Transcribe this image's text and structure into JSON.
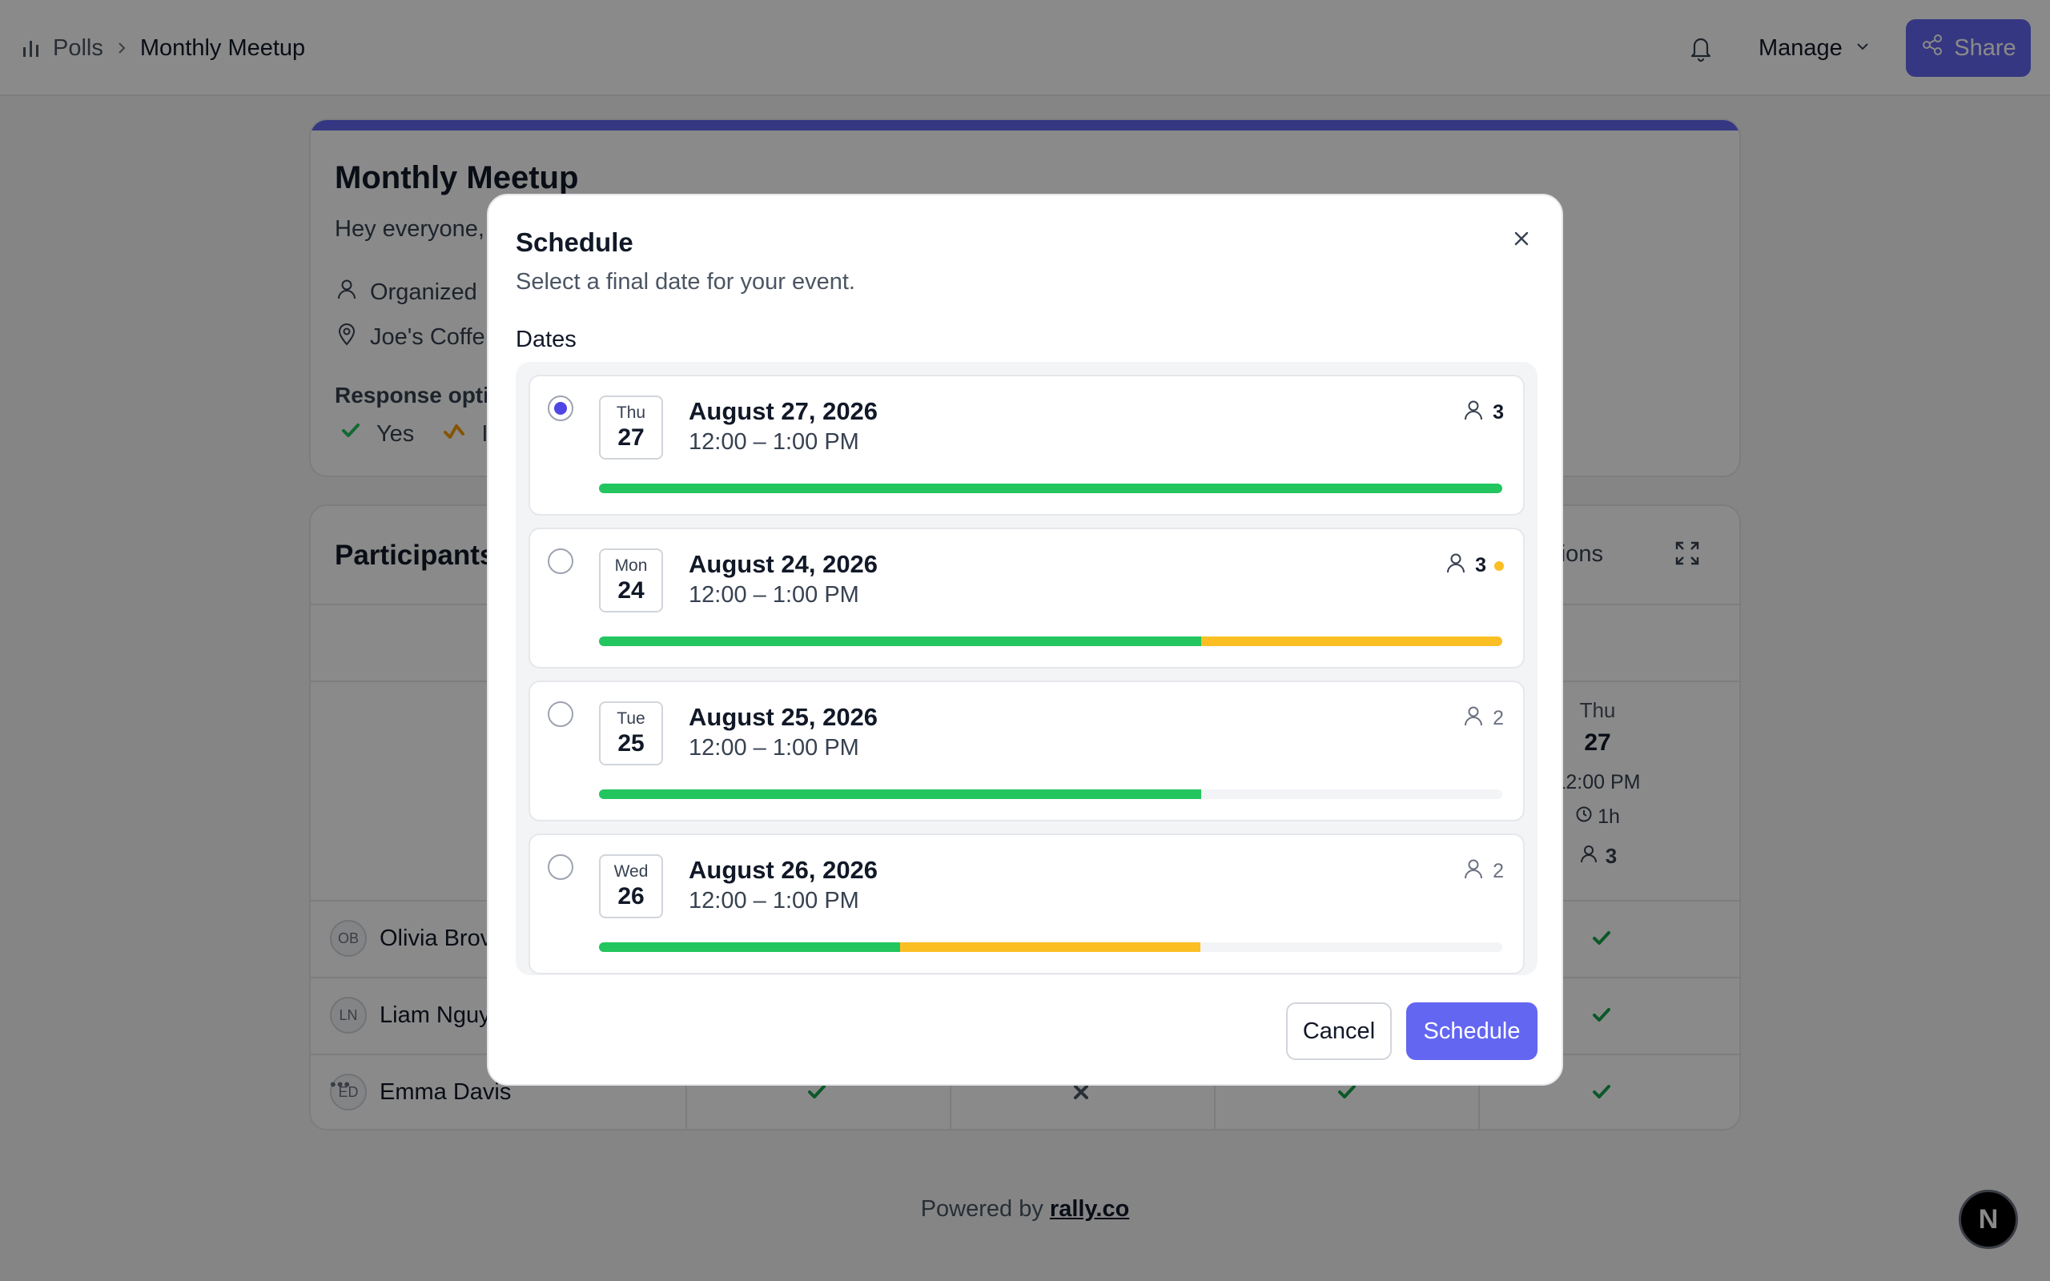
{
  "breadcrumb": {
    "root": "Polls",
    "current": "Monthly Meetup"
  },
  "header": {
    "manage_label": "Manage",
    "share_label": "Share"
  },
  "poll": {
    "title": "Monthly Meetup",
    "description": "Hey everyone,",
    "organizer_text": "Organized",
    "location": "Joe's Coffe",
    "response_label": "Response opti",
    "response_options": [
      "Yes",
      "I"
    ]
  },
  "participants": {
    "title": "Participants",
    "options_label": "Options",
    "thu_column": {
      "dow": "Thu",
      "day": "27",
      "time": "12:00 PM",
      "duration": "1h",
      "count": "3"
    },
    "rows": [
      {
        "initials": "OB",
        "name": "Olivia Brov"
      },
      {
        "initials": "LN",
        "name": "Liam Nguy"
      },
      {
        "initials": "ED",
        "name": "Emma Davis"
      }
    ]
  },
  "footer": {
    "prefix": "Powered by",
    "link": "rally.co",
    "badge": "N"
  },
  "modal": {
    "title": "Schedule",
    "subtitle": "Select a final date for your event.",
    "dates_label": "Dates",
    "options": [
      {
        "dow": "Thu",
        "day": "27",
        "date": "August 27, 2026",
        "time": "12:00 – 1:00 PM",
        "count": "3",
        "selected": true,
        "yes": 1.0,
        "maybe": 0.0,
        "ifneedbe": false
      },
      {
        "dow": "Mon",
        "day": "24",
        "date": "August 24, 2026",
        "time": "12:00 – 1:00 PM",
        "count": "3",
        "selected": false,
        "yes": 0.667,
        "maybe": 0.333,
        "ifneedbe": true
      },
      {
        "dow": "Tue",
        "day": "25",
        "date": "August 25, 2026",
        "time": "12:00 – 1:00 PM",
        "count": "2",
        "selected": false,
        "yes": 0.667,
        "maybe": 0.0,
        "ifneedbe": false
      },
      {
        "dow": "Wed",
        "day": "26",
        "date": "August 26, 2026",
        "time": "12:00 – 1:00 PM",
        "count": "2",
        "selected": false,
        "yes": 0.333,
        "maybe": 0.333,
        "ifneedbe": false
      }
    ],
    "cancel_label": "Cancel",
    "schedule_label": "Schedule"
  },
  "colors": {
    "accent": "#6366f1",
    "yes": "#22c55e",
    "maybe": "#fbbf24"
  }
}
